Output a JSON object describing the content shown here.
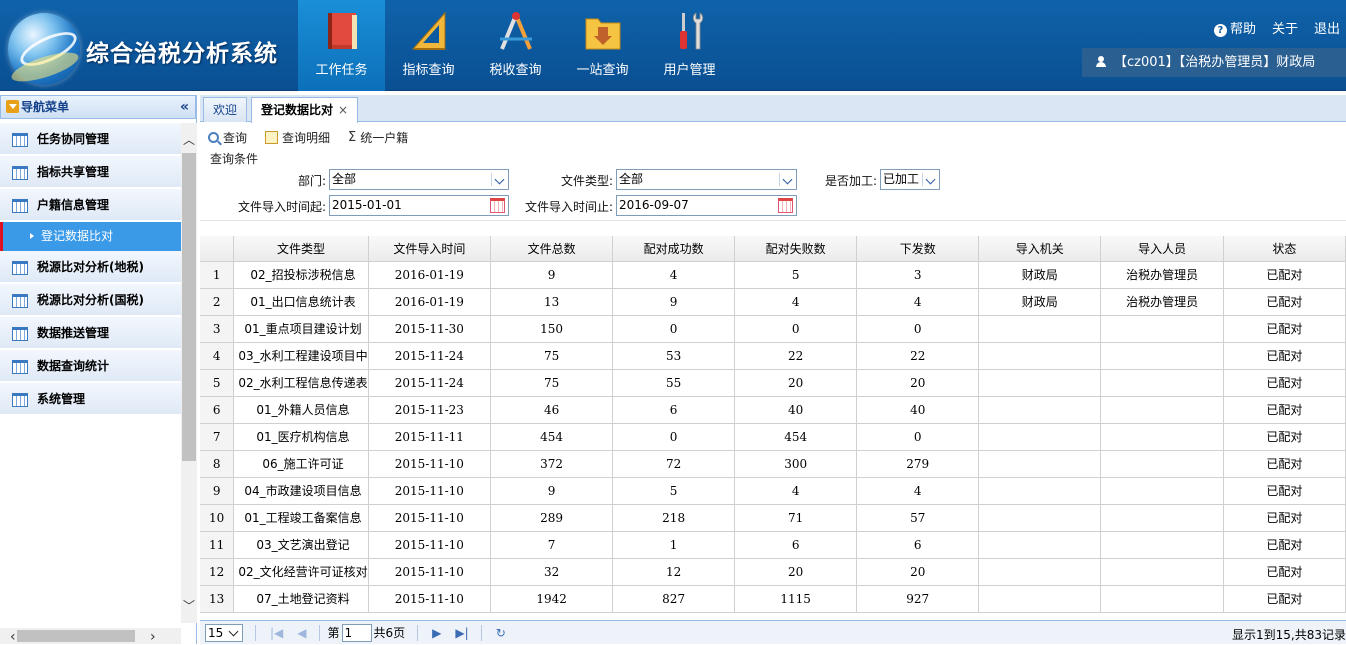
{
  "app": {
    "title": "综合治税分析系统"
  },
  "top_nav": [
    {
      "label": "工作任务",
      "icon": "book-icon"
    },
    {
      "label": "指标查询",
      "icon": "ruler-icon"
    },
    {
      "label": "税收查询",
      "icon": "compass-icon"
    },
    {
      "label": "一站查询",
      "icon": "folder-icon"
    },
    {
      "label": "用户管理",
      "icon": "tools-icon"
    }
  ],
  "top_links": {
    "help": "帮助",
    "about": "关于",
    "logout": "退出"
  },
  "user": {
    "info": "【cz001】【治税办管理员】财政局"
  },
  "sidebar": {
    "header": "导航菜单",
    "items": [
      {
        "label": "任务协同管理"
      },
      {
        "label": "指标共享管理"
      },
      {
        "label": "户籍信息管理"
      },
      {
        "label": "税源比对分析(地税)"
      },
      {
        "label": "税源比对分析(国税)"
      },
      {
        "label": "数据推送管理"
      },
      {
        "label": "数据查询统计"
      },
      {
        "label": "系统管理"
      }
    ],
    "active_sub": "登记数据比对"
  },
  "tabs": [
    {
      "label": "欢迎"
    },
    {
      "label": "登记数据比对"
    }
  ],
  "toolbar": {
    "query": "查询",
    "detail": "查询明细",
    "unify": "统一户籍"
  },
  "query": {
    "legend": "查询条件",
    "dept_label": "部门:",
    "dept_value": "全部",
    "filetype_label": "文件类型:",
    "filetype_value": "全部",
    "processed_label": "是否加工:",
    "processed_value": "已加工",
    "start_label": "文件导入时间起:",
    "start_value": "2015-01-01",
    "end_label": "文件导入时间止:",
    "end_value": "2016-09-07"
  },
  "grid": {
    "columns": [
      "文件类型",
      "文件导入时间",
      "文件总数",
      "配对成功数",
      "配对失败数",
      "下发数",
      "导入机关",
      "导入人员",
      "状态"
    ],
    "rows": [
      [
        "1",
        "02_招投标涉税信息",
        "2016-01-19",
        "9",
        "4",
        "5",
        "3",
        "财政局",
        "治税办管理员",
        "已配对"
      ],
      [
        "2",
        "01_出口信息统计表",
        "2016-01-19",
        "13",
        "9",
        "4",
        "4",
        "财政局",
        "治税办管理员",
        "已配对"
      ],
      [
        "3",
        "01_重点项目建设计划",
        "2015-11-30",
        "150",
        "0",
        "0",
        "0",
        "",
        "",
        "已配对"
      ],
      [
        "4",
        "03_水利工程建设项目中",
        "2015-11-24",
        "75",
        "53",
        "22",
        "22",
        "",
        "",
        "已配对"
      ],
      [
        "5",
        "02_水利工程信息传递表",
        "2015-11-24",
        "75",
        "55",
        "20",
        "20",
        "",
        "",
        "已配对"
      ],
      [
        "6",
        "01_外籍人员信息",
        "2015-11-23",
        "46",
        "6",
        "40",
        "40",
        "",
        "",
        "已配对"
      ],
      [
        "7",
        "01_医疗机构信息",
        "2015-11-11",
        "454",
        "0",
        "454",
        "0",
        "",
        "",
        "已配对"
      ],
      [
        "8",
        "06_施工许可证",
        "2015-11-10",
        "372",
        "72",
        "300",
        "279",
        "",
        "",
        "已配对"
      ],
      [
        "9",
        "04_市政建设项目信息",
        "2015-11-10",
        "9",
        "5",
        "4",
        "4",
        "",
        "",
        "已配对"
      ],
      [
        "10",
        "01_工程竣工备案信息",
        "2015-11-10",
        "289",
        "218",
        "71",
        "57",
        "",
        "",
        "已配对"
      ],
      [
        "11",
        "03_文艺演出登记",
        "2015-11-10",
        "7",
        "1",
        "6",
        "6",
        "",
        "",
        "已配对"
      ],
      [
        "12",
        "02_文化经营许可证核对",
        "2015-11-10",
        "32",
        "12",
        "20",
        "20",
        "",
        "",
        "已配对"
      ],
      [
        "13",
        "07_土地登记资料",
        "2015-11-10",
        "1942",
        "827",
        "1115",
        "927",
        "",
        "",
        "已配对"
      ]
    ]
  },
  "pager": {
    "page_size": "15",
    "page_prefix": "第",
    "page": "1",
    "page_total": "共6页",
    "info": "显示1到15,共83记录"
  }
}
